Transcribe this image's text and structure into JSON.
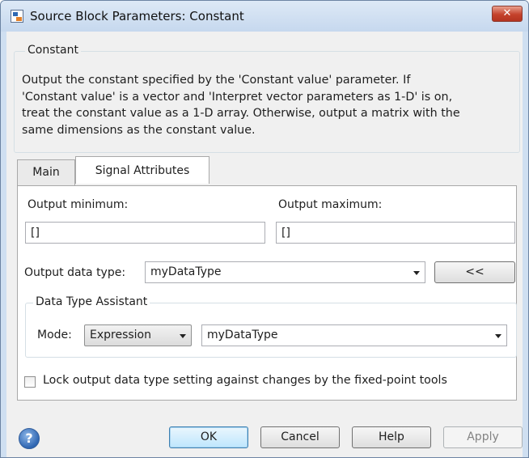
{
  "window": {
    "title": "Source Block Parameters: Constant",
    "close_label": "✕"
  },
  "block_group": {
    "title": "Constant",
    "description_lines": [
      "Output the constant specified by the 'Constant value' parameter. If",
      "'Constant value' is a vector and 'Interpret vector parameters as 1-D' is on,",
      "treat the constant value as a 1-D array. Otherwise, output a matrix with the",
      "same dimensions as the constant value."
    ]
  },
  "tabs": [
    {
      "label": "Main",
      "active": false
    },
    {
      "label": "Signal Attributes",
      "active": true
    }
  ],
  "signal_attributes": {
    "output_min_label": "Output minimum:",
    "output_min_value": "[]",
    "output_max_label": "Output maximum:",
    "output_max_value": "[]",
    "data_type_label": "Output data type:",
    "data_type_value": "myDataType",
    "assistant_toggle_label": "<<",
    "assistant": {
      "title": "Data Type Assistant",
      "mode_label": "Mode:",
      "mode_value": "Expression",
      "expression_value": "myDataType"
    },
    "lock_label": "Lock output data type setting against changes by the fixed-point tools",
    "lock_checked": false
  },
  "footer": {
    "help_icon": "question-mark",
    "ok_label": "OK",
    "cancel_label": "Cancel",
    "help_label": "Help",
    "apply_label": "Apply"
  }
}
